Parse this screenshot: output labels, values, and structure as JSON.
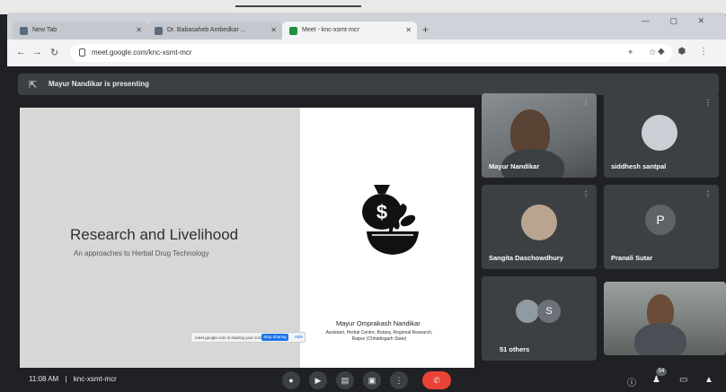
{
  "browser": {
    "tabs": [
      {
        "label": "New Tab",
        "active": false
      },
      {
        "label": "Dr. Babasaheb Ambedkar ...",
        "active": false
      },
      {
        "label": "Meet - knc-xsmt-mcr",
        "active": true
      }
    ],
    "new_tab_glyph": "+",
    "window_controls": "— ▢ ✕",
    "url": "meet.google.com/knc-xsmt-mcr",
    "nav_glyphs": {
      "back": "←",
      "forward": "→",
      "reload": "↻"
    },
    "address_right_icons": "⌖ ☆",
    "extension_icons": "◆ ⬢ ⋮"
  },
  "meet": {
    "presenting_text": "Mayur Nandikar is presenting",
    "presenting_icon": "present-icon",
    "slide": {
      "title": "Research and Livelihood",
      "subtitle": "An approaches to Herbal Drug Technology",
      "author_name": "Mayur Omprakash Nandikar",
      "author_affiliation": "Assistant, Herbal Centre, Botany, Regional Research, Raipur (Chhattisgarh State)",
      "logo_icon": "money-bag-plant-bowl-icon"
    },
    "share_toast": {
      "text": "meet.google.com is sharing your screen.",
      "stop_label": "Stop sharing",
      "hide_label": "Hide"
    },
    "participants": [
      {
        "name": "Mayur Nandikar",
        "kind": "video"
      },
      {
        "name": "siddhesh santpal",
        "kind": "avatar"
      },
      {
        "name": "Sangita Daschowdhury",
        "kind": "avatar"
      },
      {
        "name": "Pranali Sutar",
        "kind": "letter",
        "letter": "P"
      },
      {
        "name": "51 others",
        "kind": "group",
        "letter": "S"
      },
      {
        "name": "",
        "kind": "video"
      }
    ],
    "more_glyph": "⋮",
    "bottom": {
      "time": "11:08 AM",
      "separator": "|",
      "meeting_code": "knc-xsmt-mcr",
      "participants_count": "54",
      "colors": {
        "end_call": "#ea4335",
        "control_bg": "#3c4043"
      }
    }
  }
}
